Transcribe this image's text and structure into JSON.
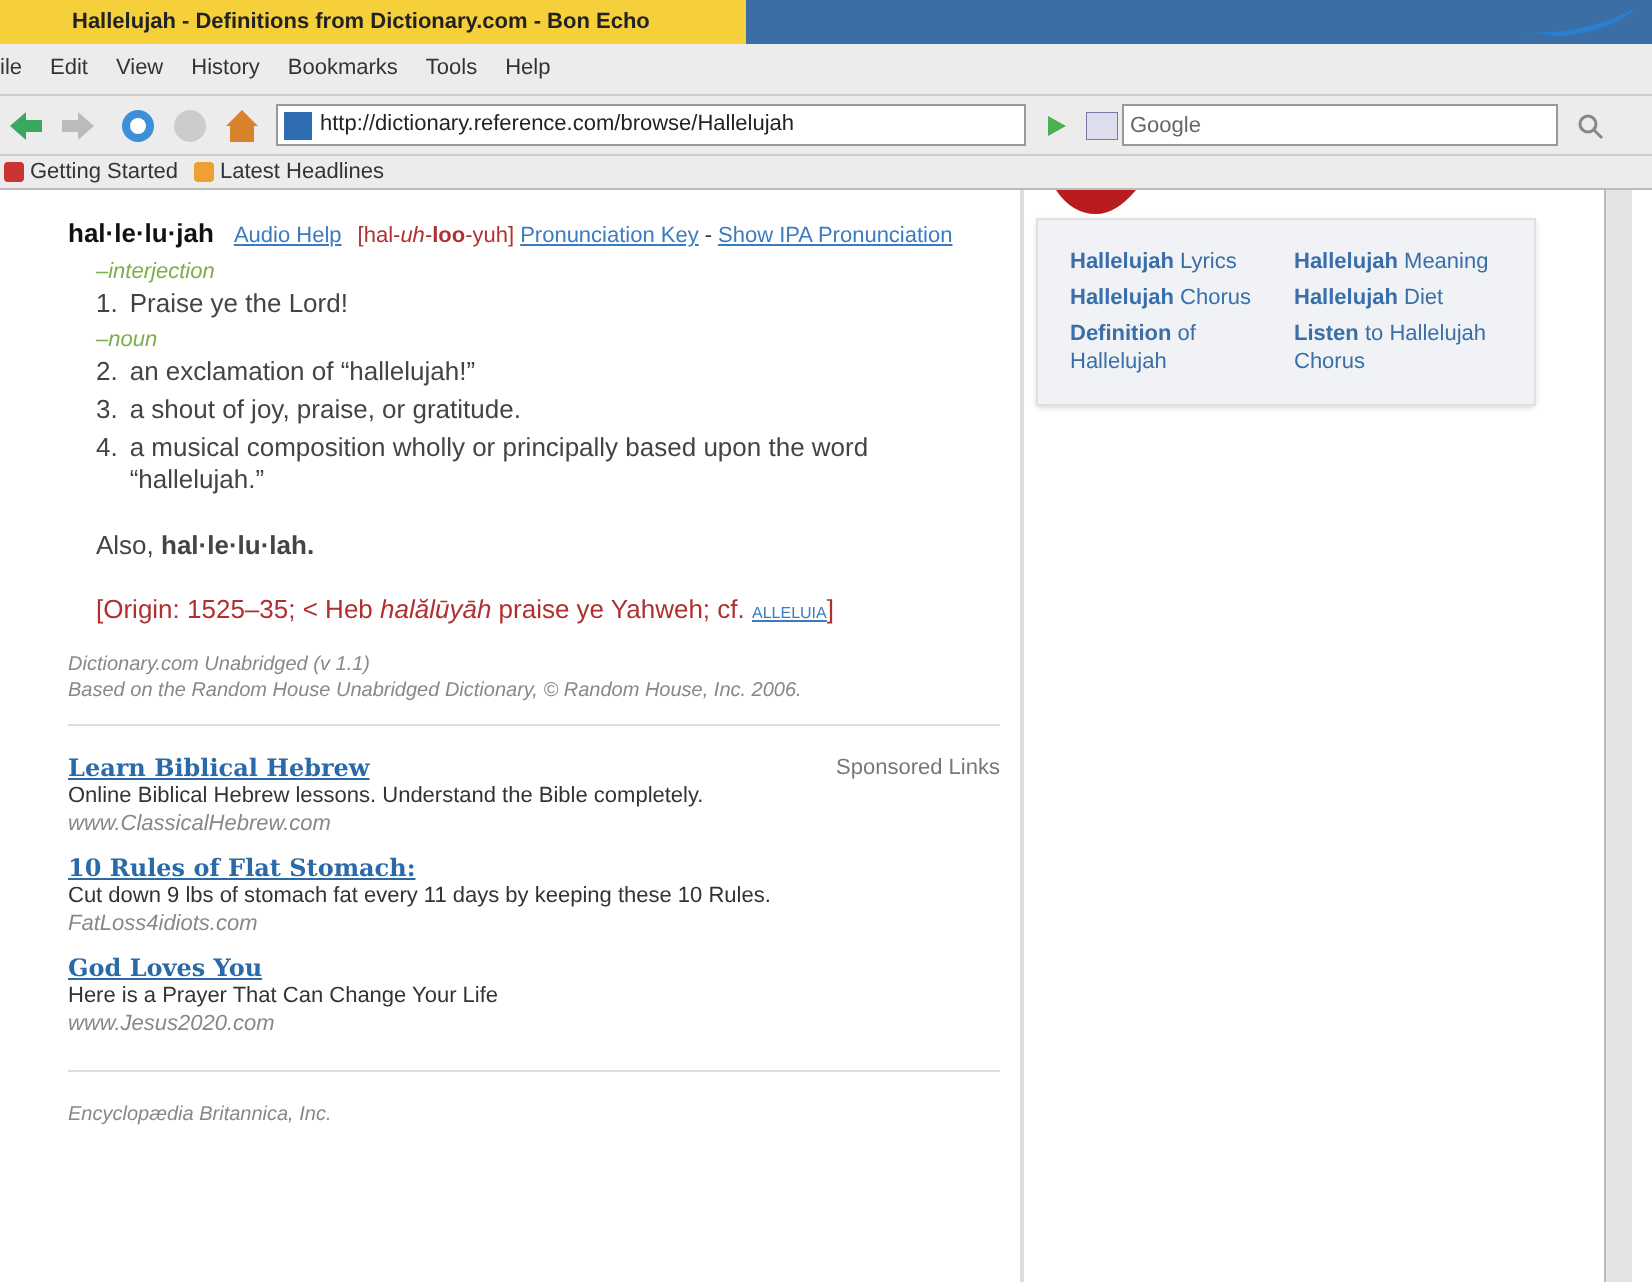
{
  "window": {
    "title": "Hallelujah - Definitions from Dictionary.com - Bon Echo"
  },
  "menu": [
    "ile",
    "Edit",
    "View",
    "History",
    "Bookmarks",
    "Tools",
    "Help"
  ],
  "address": {
    "value": "http://dictionary.reference.com/browse/Hallelujah"
  },
  "search": {
    "placeholder": "Google"
  },
  "bookmarks": [
    "Getting Started",
    "Latest Headlines"
  ],
  "entry": {
    "headword": "hal·le·lu·jah",
    "audio_help": "Audio Help",
    "pronunciation": "[hal-*uh*-**loo**-yuh]",
    "pronunciation_key": "Pronunciation Key",
    "separator": "-",
    "show_ipa": "Show IPA Pronunciation",
    "senses": [
      {
        "pos": "–interjection",
        "definitions": [
          {
            "number": "1.",
            "text": "Praise ye the Lord!"
          }
        ]
      },
      {
        "pos": "–noun",
        "definitions": [
          {
            "number": "2.",
            "text": "an exclamation of “hallelujah!”"
          },
          {
            "number": "3.",
            "text": "a shout of joy, praise, or gratitude."
          },
          {
            "number": "4.",
            "text": "a musical composition wholly or principally based upon the word “hallelujah.”"
          }
        ]
      }
    ],
    "also": "Also, **hal·le·lu·lah.**",
    "origin": "[Origin: 1525–35; < Heb *halălūyāh* praise ye Yahweh; cf.",
    "origin_link": "ALLELUIA",
    "origin_end": "]",
    "source": "Dictionary.com Unabridged (v 1.1)",
    "source_note": "Based on the Random House Unabridged Dictionary, © Random House, Inc. 2006."
  },
  "sponsored": {
    "label": "Sponsored Links",
    "ads": [
      {
        "title": "Learn Biblical Hebrew",
        "text": "Online Biblical Hebrew lessons. Understand the Bible completely.",
        "url": "www.ClassicalHebrew.com"
      },
      {
        "title": "10 Rules of Flat Stomach:",
        "text": "Cut down 9 lbs of stomach fat every 11 days by keeping these 10 Rules.",
        "url": "FatLoss4idiots.com"
      },
      {
        "title": "God Loves You",
        "text": "Here is a Prayer That Can Change Your Life",
        "url": "www.Jesus2020.com"
      }
    ]
  },
  "next_source": "Encyclopædia Britannica, Inc.",
  "related": [
    "**Hallelujah** Lyrics",
    "**Hallelujah** Meaning",
    "**Hallelujah** Chorus",
    "**Hallelujah** Diet",
    "**Definition** of Hallelujah",
    "**Listen** to Hallelujah Chorus"
  ]
}
